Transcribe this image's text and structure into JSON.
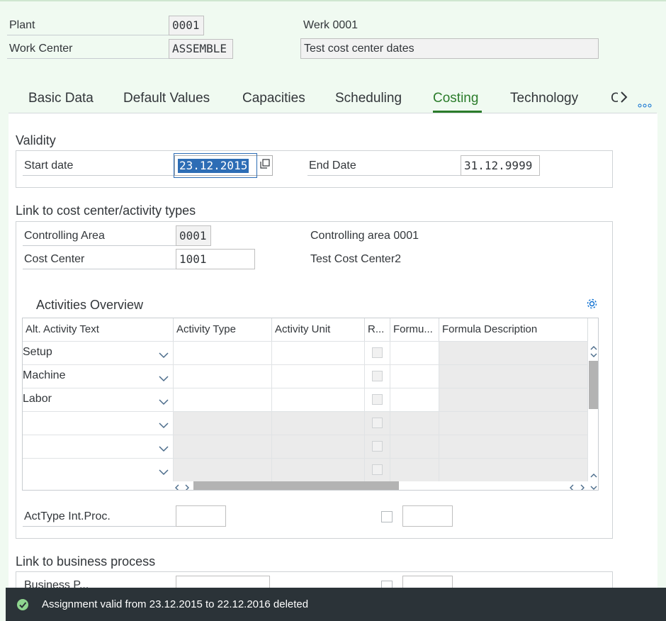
{
  "header": {
    "plant_label": "Plant",
    "plant_value": "0001",
    "plant_desc": "Werk  0001",
    "workcenter_label": "Work Center",
    "workcenter_value": "ASSEMBLE",
    "workcenter_desc": "Test cost center dates"
  },
  "tabs": [
    {
      "label": "Basic Data"
    },
    {
      "label": "Default Values"
    },
    {
      "label": "Capacities"
    },
    {
      "label": "Scheduling"
    },
    {
      "label": "Costing"
    },
    {
      "label": "Technology"
    },
    {
      "label": "C"
    }
  ],
  "active_tab": "Costing",
  "validity": {
    "title": "Validity",
    "start_label": "Start date",
    "start_value": "23.12.2015",
    "end_label": "End Date",
    "end_value": "31.12.9999"
  },
  "link_cc": {
    "title": "Link to cost center/activity types",
    "ca_label": "Controlling Area",
    "ca_value": "0001",
    "ca_desc": "Controlling area 0001",
    "cc_label": "Cost Center",
    "cc_value": "1001",
    "cc_desc": "Test Cost Center2"
  },
  "activities": {
    "title": "Activities Overview",
    "columns": [
      "Alt. Activity Text",
      "Activity Type",
      "Activity Unit",
      "R...",
      "Formu...",
      "Formula Description"
    ],
    "rows": [
      {
        "text": "Setup"
      },
      {
        "text": "Machine"
      },
      {
        "text": "Labor"
      },
      {
        "text": ""
      },
      {
        "text": ""
      },
      {
        "text": ""
      }
    ]
  },
  "acttype_int": {
    "label": "ActType Int.Proc."
  },
  "business_process": {
    "title": "Link to business process",
    "partial_label": "Business P..."
  },
  "message": {
    "text": "Assignment valid from 23.12.2015 to 22.12.2016 deleted"
  },
  "colors": {
    "accent": "#2b7c2b",
    "message_bar": "#2b3338",
    "selection": "#2d6db5"
  }
}
